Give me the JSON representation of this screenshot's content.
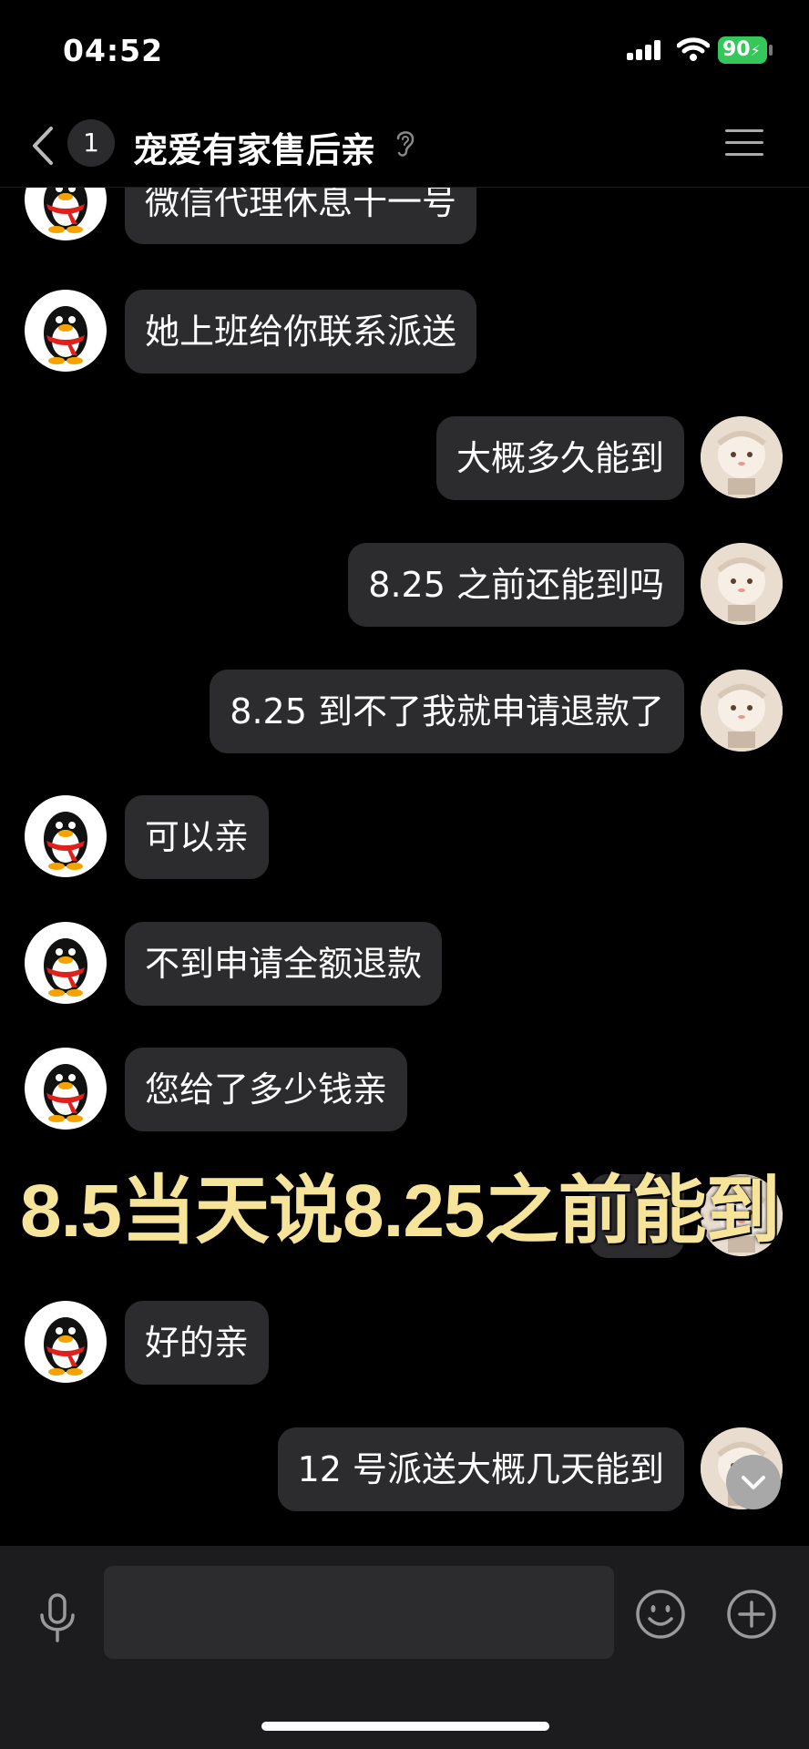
{
  "status_bar": {
    "time": "04:52",
    "battery": "90"
  },
  "header": {
    "unread_count": "1",
    "title": "宠爱有家售后亲"
  },
  "messages": [
    {
      "side": "left",
      "text": "微信代理休息十一号"
    },
    {
      "side": "left",
      "text": "她上班给你联系派送"
    },
    {
      "side": "right",
      "text": "大概多久能到"
    },
    {
      "side": "right",
      "text": "8.25 之前还能到吗"
    },
    {
      "side": "right",
      "text": "8.25 到不了我就申请退款了"
    },
    {
      "side": "left",
      "text": "可以亲"
    },
    {
      "side": "left",
      "text": "不到申请全额退款"
    },
    {
      "side": "left",
      "text": "您给了多少钱亲"
    },
    {
      "side": "right",
      "text": ""
    },
    {
      "side": "left",
      "text": "好的亲"
    },
    {
      "side": "right",
      "text": "12 号派送大概几天能到"
    }
  ],
  "overlay_caption": "8.5当天说8.25之前能到",
  "icons": {
    "back": "chevron-left-icon",
    "ear": "ear-icon",
    "menu": "menu-icon",
    "mic": "microphone-icon",
    "emoji": "emoji-icon",
    "plus": "plus-icon",
    "scroll": "chevron-down-icon"
  },
  "colors": {
    "background": "#000000",
    "bubble": "#2c2c2e",
    "caption": "#f6e49a",
    "battery": "#34c759"
  }
}
